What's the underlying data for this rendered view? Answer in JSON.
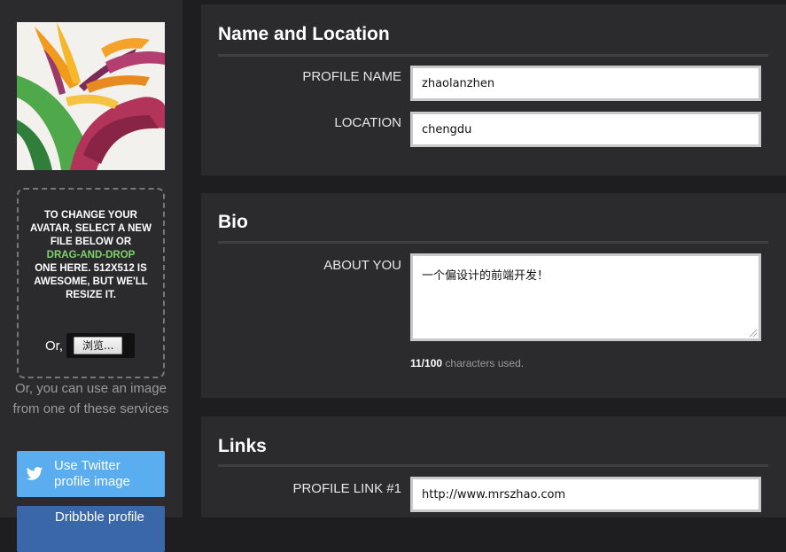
{
  "sidebar": {
    "dropzone": {
      "line_before": "To change your avatar, select a new file below or",
      "accent": "drag-and-drop",
      "line_after": "one here. 512x512 is awesome, but we'll resize it.",
      "or_label": "Or,",
      "browse_label": "浏览..."
    },
    "alt_text": "Or, you can use an image from one of these services",
    "twitter_label": "Use Twitter profile image",
    "dribbble_label": "Dribbble profile"
  },
  "sections": {
    "name_location": {
      "title": "Name and Location",
      "profile_name_label": "Profile Name",
      "profile_name_value": "zhaolanzhen",
      "location_label": "Location",
      "location_value": "chengdu"
    },
    "bio": {
      "title": "Bio",
      "about_label": "About You",
      "about_value": "一个偏设计的前端开发！",
      "char_used": "11/100",
      "char_suffix": "characters used."
    },
    "links": {
      "title": "Links",
      "link1_label": "Profile Link #1",
      "link1_value": "http://www.mrszhao.com"
    }
  },
  "colors": {
    "accent_green": "#7ed36a",
    "twitter_blue": "#5aaef0",
    "panel_bg": "#2b2b2d",
    "page_bg": "#1e1e20"
  }
}
